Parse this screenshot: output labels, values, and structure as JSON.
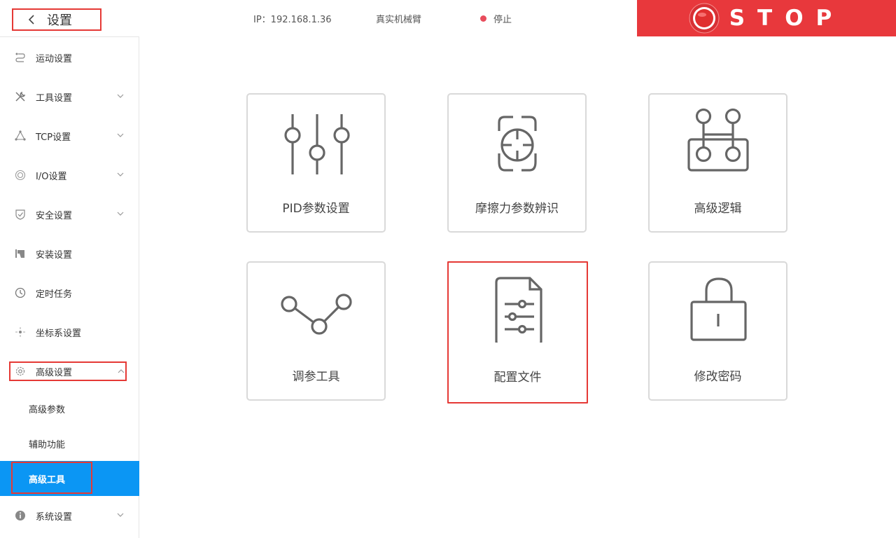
{
  "header": {
    "back_title": "设置",
    "ip": "IP：192.168.1.36",
    "mode": "真实机械臂",
    "state": "停止",
    "stop_label": "STOP",
    "state_color": "#e84c5c",
    "stop_color": "#e8383c"
  },
  "sidebar": {
    "items": [
      {
        "label": "运动设置",
        "icon": "motion-icon"
      },
      {
        "label": "工具设置",
        "icon": "tools-icon",
        "expandable": true
      },
      {
        "label": "TCP设置",
        "icon": "triangle-nodes-icon",
        "expandable": true
      },
      {
        "label": "I/O设置",
        "icon": "io-icon",
        "expandable": true
      },
      {
        "label": "安全设置",
        "icon": "shield-check-icon",
        "expandable": true
      },
      {
        "label": "安装设置",
        "icon": "install-icon"
      },
      {
        "label": "定时任务",
        "icon": "clock-icon"
      },
      {
        "label": "坐标系设置",
        "icon": "coordinate-icon"
      },
      {
        "label": "高级设置",
        "icon": "gear-icon",
        "expandable": true,
        "expanded": true
      },
      {
        "label": "系统设置",
        "icon": "info-icon",
        "expandable": true
      }
    ],
    "subitems": [
      {
        "label": "高级参数"
      },
      {
        "label": "辅助功能"
      },
      {
        "label": "高级工具",
        "active": true
      }
    ],
    "active_color": "#0b96f4"
  },
  "cards": [
    {
      "label": "PID参数设置",
      "icon": "sliders-icon"
    },
    {
      "label": "摩擦力参数辨识",
      "icon": "target-scan-icon"
    },
    {
      "label": "高级逻辑",
      "icon": "logic-board-icon"
    },
    {
      "label": "调参工具",
      "icon": "tuning-curve-icon"
    },
    {
      "label": "配置文件",
      "icon": "config-file-icon",
      "selected": true
    },
    {
      "label": "修改密码",
      "icon": "lock-icon"
    }
  ],
  "highlight_color": "#e53935"
}
